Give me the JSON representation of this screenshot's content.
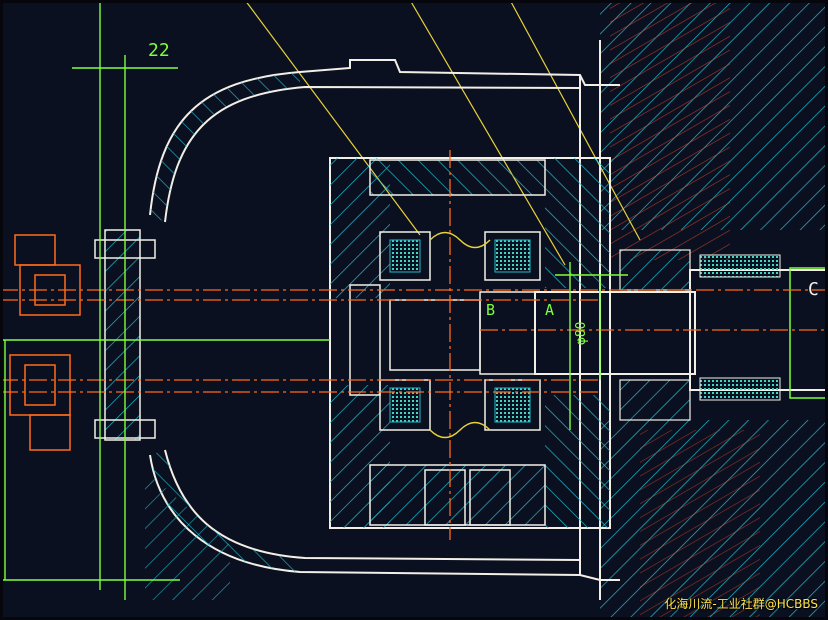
{
  "labels": {
    "dim_top": "22",
    "section_b": "B",
    "section_a": "A",
    "diameter": "φ80",
    "section_c": "C"
  },
  "watermark": "化海川流-工业社群@HCBBS",
  "colors": {
    "background": "#0b1020",
    "outline": "#f2efe6",
    "hatch": "#22b8c8",
    "centerline": "#ff6a1a",
    "dimension": "#7dff3a",
    "guide": "#e8d23a"
  }
}
